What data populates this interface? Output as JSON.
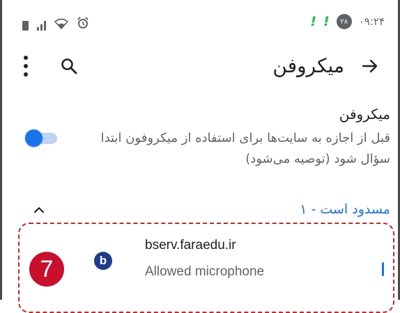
{
  "status_bar": {
    "time": "۰۹:۲۴",
    "notification_badge": "۲۸",
    "alert_glyph": "!",
    "icons": [
      "sim-icon",
      "signal-icon",
      "wifi-icon",
      "alarm-icon"
    ]
  },
  "app_bar": {
    "title": "میکروفن",
    "icons": [
      "more-vert-icon",
      "search-icon",
      "back-arrow-icon"
    ]
  },
  "setting": {
    "title": "میکروفن",
    "description": "قبل از اجازه به سایت‌ها برای استفاده از میکروفون ابتدا سؤال شود (توصیه می‌شود)",
    "toggle_on": true
  },
  "section": {
    "header": "مسدود است - ۱",
    "expanded": true
  },
  "site": {
    "name": "bserv.faraedu.ir",
    "status": "Allowed microphone",
    "icon_letter": "b"
  },
  "annotation": {
    "step_number": "7"
  },
  "colors": {
    "accent": "#1a73e8",
    "annotation_red": "#c8102e",
    "alert_green": "#1db954"
  }
}
